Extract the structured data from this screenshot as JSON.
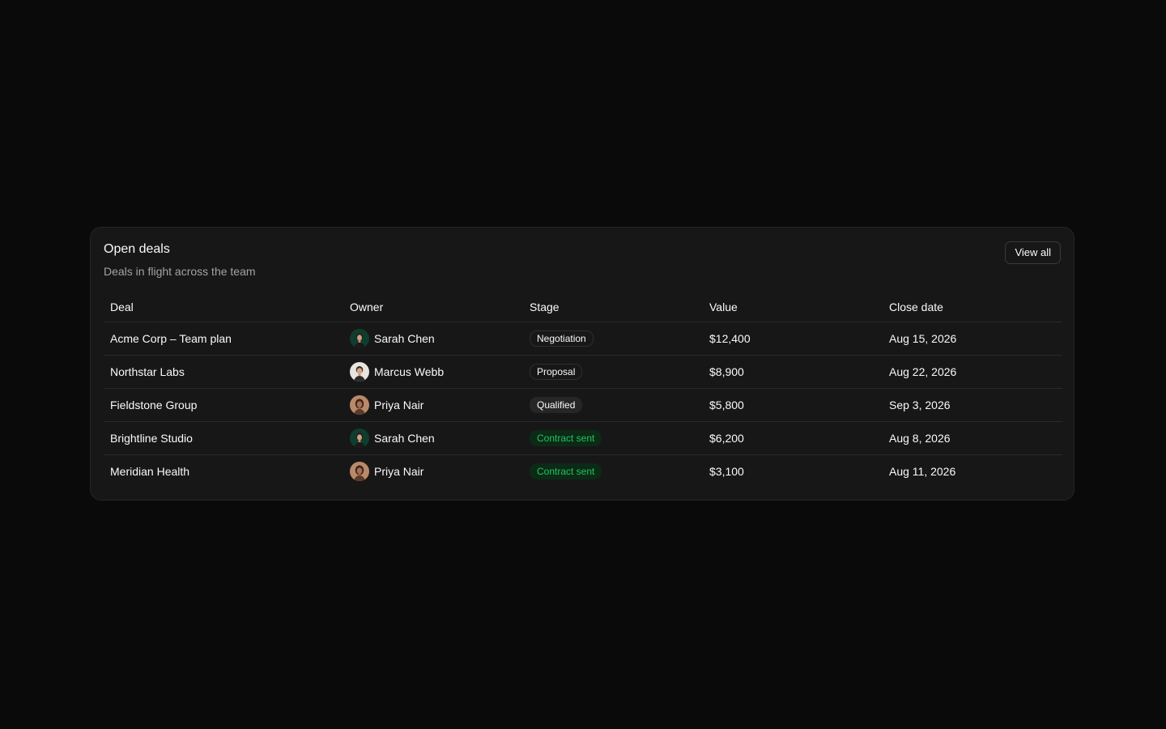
{
  "card": {
    "title": "Open deals",
    "subtitle": "Deals in flight across the team",
    "view_all_label": "View all"
  },
  "table": {
    "headers": {
      "deal": "Deal",
      "owner": "Owner",
      "stage": "Stage",
      "value": "Value",
      "close_date": "Close date"
    },
    "rows": [
      {
        "deal": "Acme Corp – Team plan",
        "owner": "Sarah Chen",
        "avatar": "avatar-sarah-chen",
        "stage": "Negotiation",
        "stage_style": "outline",
        "value": "$12,400",
        "close_date": "Aug 15, 2026"
      },
      {
        "deal": "Northstar Labs",
        "owner": "Marcus Webb",
        "avatar": "avatar-marcus-webb",
        "stage": "Proposal",
        "stage_style": "outline",
        "value": "$8,900",
        "close_date": "Aug 22, 2026"
      },
      {
        "deal": "Fieldstone Group",
        "owner": "Priya Nair",
        "avatar": "avatar-priya-nair",
        "stage": "Qualified",
        "stage_style": "muted",
        "value": "$5,800",
        "close_date": "Sep 3, 2026"
      },
      {
        "deal": "Brightline Studio",
        "owner": "Sarah Chen",
        "avatar": "avatar-sarah-chen",
        "stage": "Contract sent",
        "stage_style": "green",
        "value": "$6,200",
        "close_date": "Aug 8, 2026"
      },
      {
        "deal": "Meridian Health",
        "owner": "Priya Nair",
        "avatar": "avatar-priya-nair",
        "stage": "Contract sent",
        "stage_style": "green",
        "value": "$3,100",
        "close_date": "Aug 11, 2026"
      }
    ]
  },
  "colors": {
    "background": "#0a0a0a",
    "card": "#171717",
    "border": "#262626",
    "muted_text": "#a3a3a3",
    "success_text": "#22c55e",
    "success_bg": "#0c2a16"
  }
}
